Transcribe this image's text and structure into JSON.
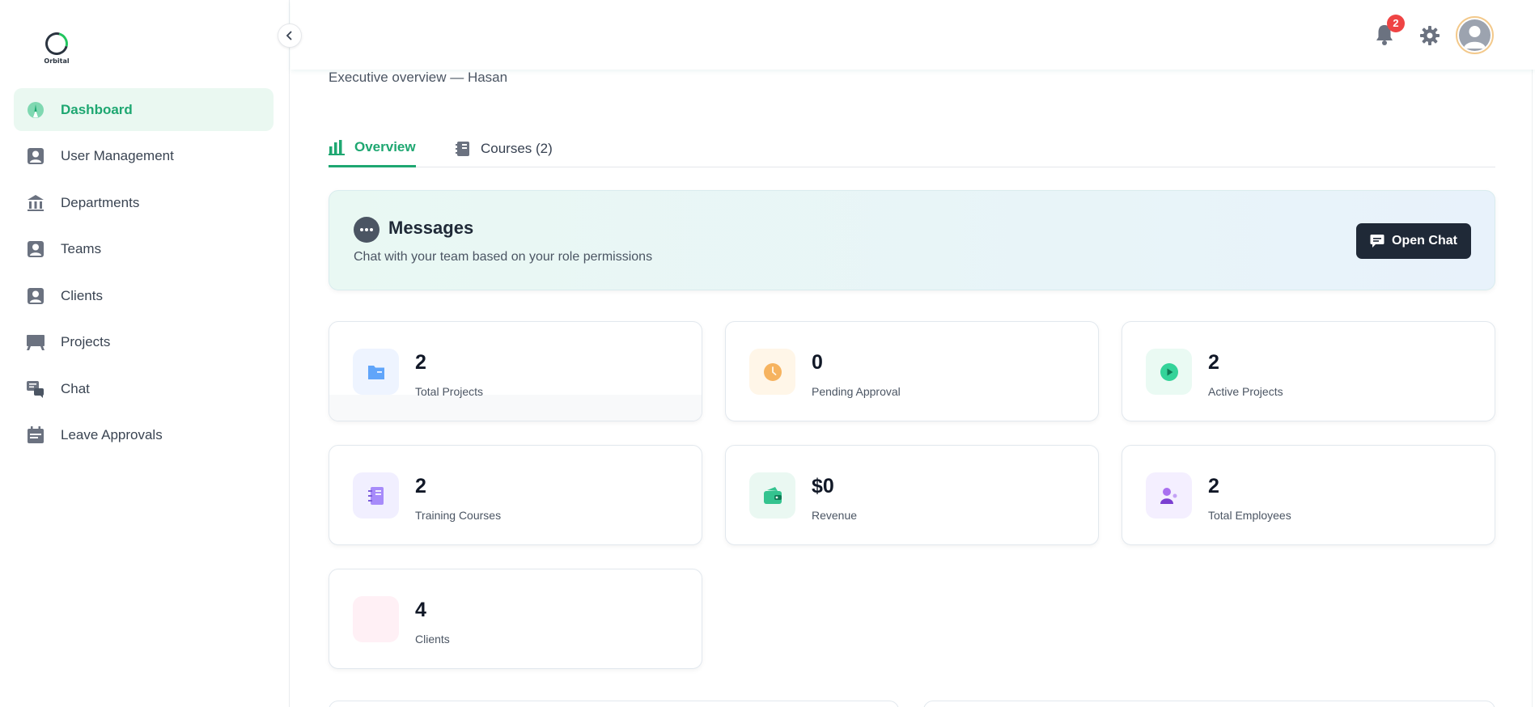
{
  "app": {
    "logo_text": "Orbital"
  },
  "sidebar": {
    "items": [
      {
        "label": "Dashboard",
        "icon": "dashboard-gauge-icon",
        "active": true
      },
      {
        "label": "User Management",
        "icon": "user-icon"
      },
      {
        "label": "Departments",
        "icon": "building-icon"
      },
      {
        "label": "Teams",
        "icon": "user-icon"
      },
      {
        "label": "Clients",
        "icon": "user-icon"
      },
      {
        "label": "Projects",
        "icon": "board-icon"
      },
      {
        "label": "Chat",
        "icon": "chat-icon"
      },
      {
        "label": "Leave Approvals",
        "icon": "calendar-icon"
      }
    ]
  },
  "header": {
    "notifications_count": "2"
  },
  "main": {
    "subtitle": "Executive overview — Hasan",
    "tabs": [
      {
        "label": "Overview",
        "icon": "bar-chart-icon",
        "active": true
      },
      {
        "label": "Courses (2)",
        "icon": "notebook-icon"
      }
    ],
    "messages": {
      "title": "Messages",
      "description": "Chat with your team based on your role permissions",
      "button_label": "Open Chat"
    },
    "stats": [
      {
        "value": "2",
        "label": "Total Projects",
        "icon": "folder-icon",
        "color": "#60a5fa",
        "bg": "#eef4ff"
      },
      {
        "value": "0",
        "label": "Pending Approval",
        "icon": "clock-icon",
        "color": "#f6b35f",
        "bg": "#fff6e8"
      },
      {
        "value": "2",
        "label": "Active Projects",
        "icon": "play-icon",
        "color": "#34d399",
        "bg": "#eafaf3"
      },
      {
        "value": "2",
        "label": "Training Courses",
        "icon": "notebook-icon",
        "color": "#a78bfa",
        "bg": "#f1efff"
      },
      {
        "value": "$0",
        "label": "Revenue",
        "icon": "wallet-icon",
        "color": "#34c38f",
        "bg": "#eaf8f2"
      },
      {
        "value": "2",
        "label": "Total Employees",
        "icon": "users-icon",
        "color": "#a970f0",
        "bg": "#f4efff"
      },
      {
        "value": "4",
        "label": "Clients",
        "icon": "clients-icon",
        "color": "#f9a8c4",
        "bg": "#fff0f5"
      }
    ]
  },
  "colors": {
    "accent": "#1ea771",
    "dark": "#1f2937",
    "badge": "#ef4444"
  }
}
